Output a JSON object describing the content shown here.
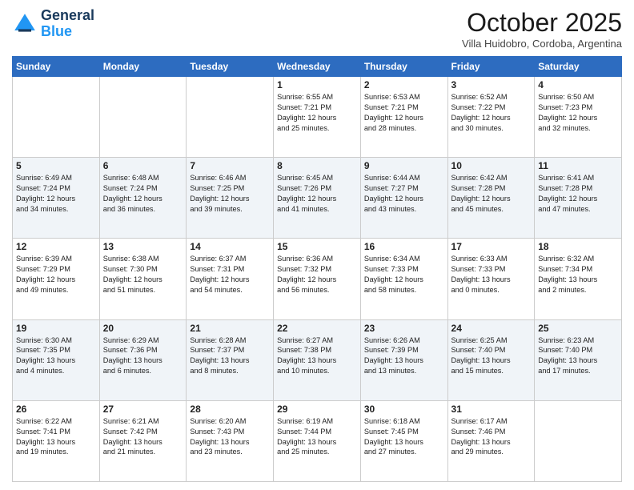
{
  "header": {
    "logo_line1": "General",
    "logo_line2": "Blue",
    "month": "October 2025",
    "location": "Villa Huidobro, Cordoba, Argentina"
  },
  "weekdays": [
    "Sunday",
    "Monday",
    "Tuesday",
    "Wednesday",
    "Thursday",
    "Friday",
    "Saturday"
  ],
  "rows": [
    [
      {
        "day": "",
        "info": ""
      },
      {
        "day": "",
        "info": ""
      },
      {
        "day": "",
        "info": ""
      },
      {
        "day": "1",
        "info": "Sunrise: 6:55 AM\nSunset: 7:21 PM\nDaylight: 12 hours\nand 25 minutes."
      },
      {
        "day": "2",
        "info": "Sunrise: 6:53 AM\nSunset: 7:21 PM\nDaylight: 12 hours\nand 28 minutes."
      },
      {
        "day": "3",
        "info": "Sunrise: 6:52 AM\nSunset: 7:22 PM\nDaylight: 12 hours\nand 30 minutes."
      },
      {
        "day": "4",
        "info": "Sunrise: 6:50 AM\nSunset: 7:23 PM\nDaylight: 12 hours\nand 32 minutes."
      }
    ],
    [
      {
        "day": "5",
        "info": "Sunrise: 6:49 AM\nSunset: 7:24 PM\nDaylight: 12 hours\nand 34 minutes."
      },
      {
        "day": "6",
        "info": "Sunrise: 6:48 AM\nSunset: 7:24 PM\nDaylight: 12 hours\nand 36 minutes."
      },
      {
        "day": "7",
        "info": "Sunrise: 6:46 AM\nSunset: 7:25 PM\nDaylight: 12 hours\nand 39 minutes."
      },
      {
        "day": "8",
        "info": "Sunrise: 6:45 AM\nSunset: 7:26 PM\nDaylight: 12 hours\nand 41 minutes."
      },
      {
        "day": "9",
        "info": "Sunrise: 6:44 AM\nSunset: 7:27 PM\nDaylight: 12 hours\nand 43 minutes."
      },
      {
        "day": "10",
        "info": "Sunrise: 6:42 AM\nSunset: 7:28 PM\nDaylight: 12 hours\nand 45 minutes."
      },
      {
        "day": "11",
        "info": "Sunrise: 6:41 AM\nSunset: 7:28 PM\nDaylight: 12 hours\nand 47 minutes."
      }
    ],
    [
      {
        "day": "12",
        "info": "Sunrise: 6:39 AM\nSunset: 7:29 PM\nDaylight: 12 hours\nand 49 minutes."
      },
      {
        "day": "13",
        "info": "Sunrise: 6:38 AM\nSunset: 7:30 PM\nDaylight: 12 hours\nand 51 minutes."
      },
      {
        "day": "14",
        "info": "Sunrise: 6:37 AM\nSunset: 7:31 PM\nDaylight: 12 hours\nand 54 minutes."
      },
      {
        "day": "15",
        "info": "Sunrise: 6:36 AM\nSunset: 7:32 PM\nDaylight: 12 hours\nand 56 minutes."
      },
      {
        "day": "16",
        "info": "Sunrise: 6:34 AM\nSunset: 7:33 PM\nDaylight: 12 hours\nand 58 minutes."
      },
      {
        "day": "17",
        "info": "Sunrise: 6:33 AM\nSunset: 7:33 PM\nDaylight: 13 hours\nand 0 minutes."
      },
      {
        "day": "18",
        "info": "Sunrise: 6:32 AM\nSunset: 7:34 PM\nDaylight: 13 hours\nand 2 minutes."
      }
    ],
    [
      {
        "day": "19",
        "info": "Sunrise: 6:30 AM\nSunset: 7:35 PM\nDaylight: 13 hours\nand 4 minutes."
      },
      {
        "day": "20",
        "info": "Sunrise: 6:29 AM\nSunset: 7:36 PM\nDaylight: 13 hours\nand 6 minutes."
      },
      {
        "day": "21",
        "info": "Sunrise: 6:28 AM\nSunset: 7:37 PM\nDaylight: 13 hours\nand 8 minutes."
      },
      {
        "day": "22",
        "info": "Sunrise: 6:27 AM\nSunset: 7:38 PM\nDaylight: 13 hours\nand 10 minutes."
      },
      {
        "day": "23",
        "info": "Sunrise: 6:26 AM\nSunset: 7:39 PM\nDaylight: 13 hours\nand 13 minutes."
      },
      {
        "day": "24",
        "info": "Sunrise: 6:25 AM\nSunset: 7:40 PM\nDaylight: 13 hours\nand 15 minutes."
      },
      {
        "day": "25",
        "info": "Sunrise: 6:23 AM\nSunset: 7:40 PM\nDaylight: 13 hours\nand 17 minutes."
      }
    ],
    [
      {
        "day": "26",
        "info": "Sunrise: 6:22 AM\nSunset: 7:41 PM\nDaylight: 13 hours\nand 19 minutes."
      },
      {
        "day": "27",
        "info": "Sunrise: 6:21 AM\nSunset: 7:42 PM\nDaylight: 13 hours\nand 21 minutes."
      },
      {
        "day": "28",
        "info": "Sunrise: 6:20 AM\nSunset: 7:43 PM\nDaylight: 13 hours\nand 23 minutes."
      },
      {
        "day": "29",
        "info": "Sunrise: 6:19 AM\nSunset: 7:44 PM\nDaylight: 13 hours\nand 25 minutes."
      },
      {
        "day": "30",
        "info": "Sunrise: 6:18 AM\nSunset: 7:45 PM\nDaylight: 13 hours\nand 27 minutes."
      },
      {
        "day": "31",
        "info": "Sunrise: 6:17 AM\nSunset: 7:46 PM\nDaylight: 13 hours\nand 29 minutes."
      },
      {
        "day": "",
        "info": ""
      }
    ]
  ]
}
